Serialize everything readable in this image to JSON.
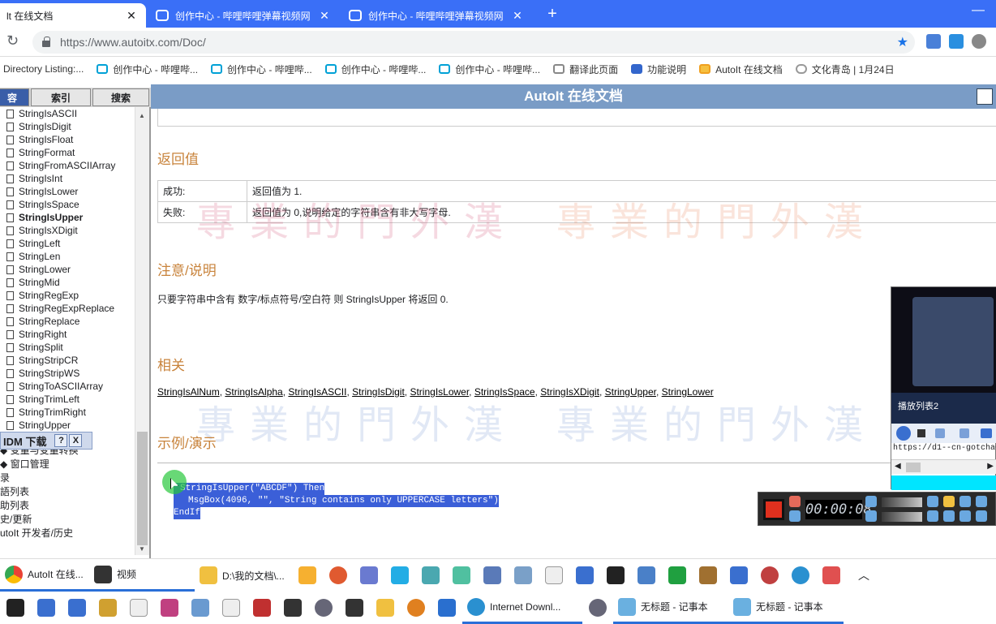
{
  "browser": {
    "tabs": [
      {
        "title": "lt 在线文档",
        "active": true
      },
      {
        "title": "创作中心 - 哔哩哔哩弹幕视频网",
        "active": false
      },
      {
        "title": "创作中心 - 哔哩哔哩弹幕视频网",
        "active": false
      }
    ],
    "new_tab_label": "+",
    "close_glyph": "✕",
    "url": "https://www.autoitx.com/Doc/",
    "bookmarks": [
      "Directory Listing:...",
      "创作中心 - 哔哩哔...",
      "创作中心 - 哔哩哔...",
      "创作中心 - 哔哩哔...",
      "创作中心 - 哔哩哔...",
      "翻译此页面",
      "功能说明",
      "AutoIt 在线文档",
      "文化青岛 | 1月24日"
    ],
    "colors": {
      "chrome_blue": "#3a6ff7",
      "header_blue": "#7a9cc6",
      "heading_orange": "#c8833b"
    }
  },
  "doc": {
    "header_title": "AutoIt 在线文档",
    "left_tabs": [
      "容",
      "索引",
      "搜索"
    ],
    "toc_items": [
      "StringIsASCII",
      "StringIsDigit",
      "StringIsFloat",
      "StringFormat",
      "StringFromASCIIArray",
      "StringIsInt",
      "StringIsLower",
      "StringIsSpace",
      "StringIsUpper",
      "StringIsXDigit",
      "StringLeft",
      "StringLen",
      "StringLower",
      "StringMid",
      "StringRegExp",
      "StringRegExpReplace",
      "StringReplace",
      "StringRight",
      "StringSplit",
      "StringStripCR",
      "StringStripWS",
      "StringToASCIIArray",
      "StringTrimLeft",
      "StringTrimRight",
      "StringUpper"
    ],
    "toc_current": "StringIsUpper",
    "toc_folders": [
      "变量与变量转换",
      "窗口管理",
      "录",
      "語列表",
      "助列表",
      "史/更新",
      "utoIt 开发者/历史"
    ],
    "idm_label": "IDM 下载",
    "idm_help": "?",
    "idm_close": "X",
    "sections": {
      "return_value": "返回值",
      "remarks": "注意/说明",
      "related": "相关",
      "example": "示例/演示"
    },
    "return_rows": [
      {
        "k": "成功:",
        "v": "返回值为 1."
      },
      {
        "k": "失败:",
        "v": "返回值为 0,说明给定的字符串含有非大写字母."
      }
    ],
    "remark_text": "只要字符串中含有 数字/标点符号/空白符 则 StringIsUpper 将返回 0.",
    "related_links": [
      "StringIsAlNum",
      "StringIsAlpha",
      "StringIsASCII",
      "StringIsDigit",
      "StringIsLower",
      "StringIsSpace",
      "StringIsXDigit",
      "StringUpper",
      "StringLower"
    ],
    "code_lines": [
      "StringIsUpper(\"ABCDF\") Then",
      "MsgBox(4096, \"\", \"String contains only UPPERCASE letters\")",
      "EndIf"
    ],
    "watermark": "專業的門外漢"
  },
  "player": {
    "playlist_label": "播放列表2",
    "url_text": "https://d1--cn-gotcha0"
  },
  "recorder": {
    "time": "00:00:08"
  },
  "taskbar": {
    "row1": [
      "AutoIt 在线...",
      "视频",
      "D:\\我的文档\\..."
    ],
    "row2": [
      "Internet Downl...",
      "无标题 - 记事本",
      "无标题 - 记事本"
    ]
  }
}
